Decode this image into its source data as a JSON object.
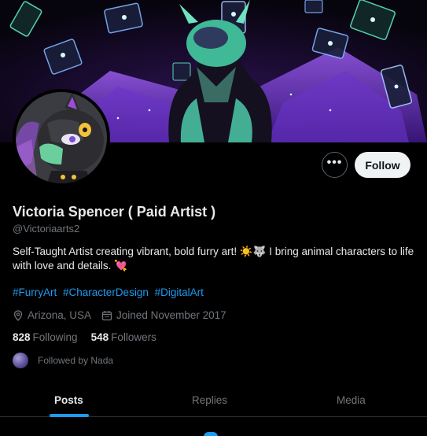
{
  "profile": {
    "name": "Victoria Spencer ( Paid Artist )",
    "handle": "@Victoriaarts2",
    "bio": "Self-Taught Artist creating vibrant, bold furry art! ☀️🐺 I bring animal characters to life with love and details. 💘",
    "hashtags": [
      "#FurryArt",
      "#CharacterDesign",
      "#DigitalArt"
    ],
    "location": "Arizona, USA",
    "joined": "Joined November 2017",
    "following_count": "828",
    "following_label": "Following",
    "followers_count": "548",
    "followers_label": "Followers",
    "followed_by": "Followed by Nada"
  },
  "actions": {
    "more_label": "•••",
    "follow_label": "Follow"
  },
  "tabs": [
    {
      "label": "Posts",
      "active": true
    },
    {
      "label": "Replies",
      "active": false
    },
    {
      "label": "Media",
      "active": false
    }
  ],
  "colors": {
    "accent": "#1d9bf0",
    "background": "#000000",
    "muted_text": "#71767b",
    "banner_purple": "#7b3fd6",
    "banner_mint": "#3fd6a8"
  },
  "icons": [
    "location-pin-icon",
    "calendar-icon",
    "more-options-icon"
  ]
}
